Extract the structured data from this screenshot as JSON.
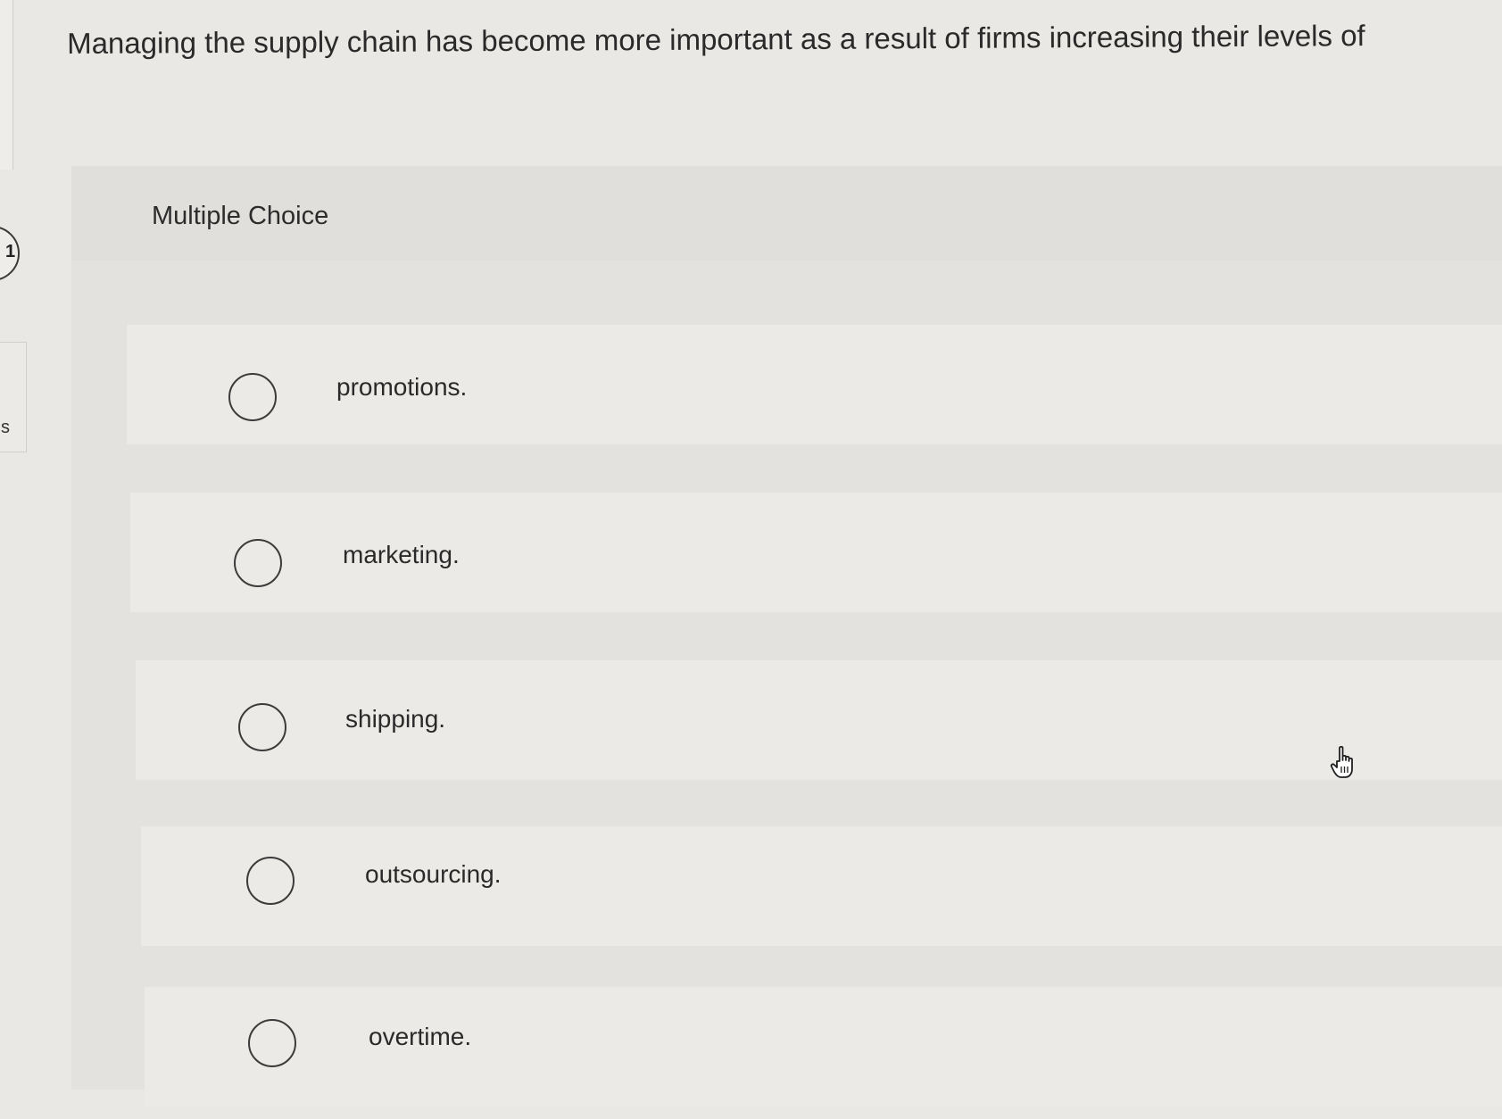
{
  "question": {
    "text": "Managing the supply chain has become more important as a result of firms increasing their levels of"
  },
  "panel": {
    "type_label": "Multiple Choice"
  },
  "options": [
    {
      "label": "promotions.",
      "selected": false
    },
    {
      "label": "marketing.",
      "selected": false
    },
    {
      "label": "shipping.",
      "selected": false
    },
    {
      "label": "outsourcing.",
      "selected": false
    },
    {
      "label": "overtime.",
      "selected": false
    }
  ],
  "side_nav": {
    "question_number": "1",
    "tab_letter": "s"
  },
  "icons": {
    "cursor": "hand-pointer-icon"
  }
}
